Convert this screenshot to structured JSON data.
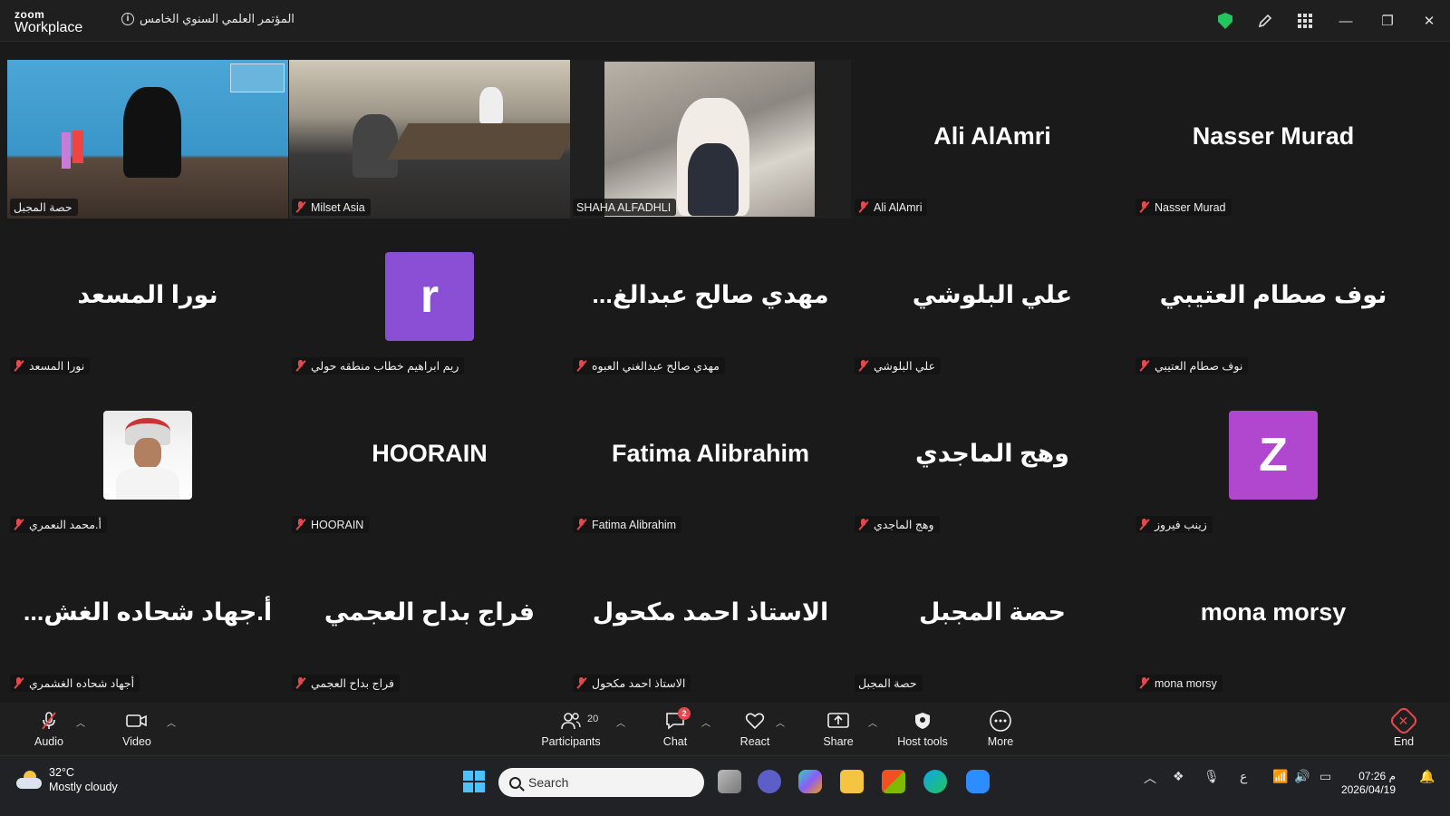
{
  "app": {
    "logo_line1": "zoom",
    "logo_line2": "Workplace",
    "meeting_title": "المؤتمر العلمي السنوي الخامس"
  },
  "window_controls": {
    "minimize": "—",
    "restore": "❐",
    "close": "✕"
  },
  "tiles": [
    {
      "type": "video",
      "label": "حصة المجبل",
      "muted": false
    },
    {
      "type": "video",
      "label": "Milset Asia",
      "muted": true
    },
    {
      "type": "video",
      "label": "SHAHA ALFADHLI",
      "muted": false,
      "active": true
    },
    {
      "type": "name",
      "big": "Ali AlAmri",
      "label": "Ali AlAmri",
      "muted": true
    },
    {
      "type": "name",
      "big": "Nasser Murad",
      "label": "Nasser Murad",
      "muted": true
    },
    {
      "type": "name",
      "big": "نورا المسعد",
      "label": "نورا المسعد",
      "muted": true
    },
    {
      "type": "avatar",
      "letter": "r",
      "color": "#8b4fd6",
      "label": "ريم ابراهيم خطاب منطقه حولي",
      "muted": true
    },
    {
      "type": "name",
      "big": "...مهدي صالح عبدالغ",
      "label": "مهدي صالح عبدالغني العبوه",
      "muted": true
    },
    {
      "type": "name",
      "big": "علي البلوشي",
      "label": "علي البلوشي",
      "muted": true
    },
    {
      "type": "name",
      "big": "نوف صطام العتيبي",
      "label": "نوف صطام العتيبي",
      "muted": true
    },
    {
      "type": "photo",
      "label": "أ.محمد النعمري",
      "muted": true
    },
    {
      "type": "name",
      "big": "HOORAIN",
      "label": "HOORAIN",
      "muted": true
    },
    {
      "type": "name",
      "big": "Fatima Alibrahim",
      "label": "Fatima Alibrahim",
      "muted": true
    },
    {
      "type": "name",
      "big": "وهج الماجدي",
      "label": "وهج الماجدي",
      "muted": true
    },
    {
      "type": "avatar",
      "letter": "Z",
      "color": "#b247cf",
      "label": "زينب فيروز",
      "muted": true
    },
    {
      "type": "name",
      "big": "...أ.جهاد شحاده الغش",
      "label": "أجهاد شحاده الغشمري",
      "muted": true
    },
    {
      "type": "name",
      "big": "فراج بداح العجمي",
      "label": "فراج بداح العجمي",
      "muted": true
    },
    {
      "type": "name",
      "big": "الاستاذ احمد مكحول",
      "label": "الاستاذ احمد مكحول",
      "muted": true
    },
    {
      "type": "name",
      "big": "حصة المجبل",
      "label": "حصة المجبل",
      "muted": false
    },
    {
      "type": "name",
      "big": "mona morsy",
      "label": "mona morsy",
      "muted": true
    }
  ],
  "toolbar": {
    "audio": "Audio",
    "video": "Video",
    "participants": "Participants",
    "participants_count": "20",
    "chat": "Chat",
    "chat_badge": "2",
    "react": "React",
    "share": "Share",
    "host_tools": "Host tools",
    "more": "More",
    "end": "End"
  },
  "taskbar": {
    "temp": "32°C",
    "weather": "Mostly cloudy",
    "search_placeholder": "Search",
    "lang": "ع",
    "time": "07:26 م",
    "date": "2026/04/19"
  },
  "colors": {
    "accent_green": "#22c55e",
    "mute_red": "#e5484d",
    "bg": "#1a1a1a"
  }
}
